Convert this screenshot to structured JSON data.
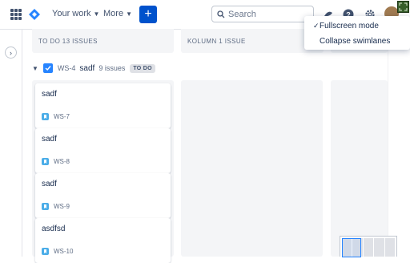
{
  "nav": {
    "your_work": "Your work",
    "more": "More",
    "create": "+",
    "search_placeholder": "Search"
  },
  "columns": [
    {
      "header": "TO DO 13 ISSUES"
    },
    {
      "header": "KOLUMN 1 ISSUE"
    }
  ],
  "swimlane": {
    "key": "WS-4",
    "summary": "sadf",
    "count": "9 issues",
    "status": "TO DO"
  },
  "cards": [
    {
      "title": "sadf",
      "key": "WS-7"
    },
    {
      "title": "sadf",
      "key": "WS-8"
    },
    {
      "title": "sadf",
      "key": "WS-9"
    },
    {
      "title": "asdfsd",
      "key": "WS-10"
    }
  ],
  "menu": {
    "fullscreen": "Fullscreen mode",
    "fullscreen_checked": "✓",
    "collapse": "Collapse swimlanes"
  },
  "colors": {
    "accent": "#0052cc",
    "story": "#4bade8",
    "column_bg": "#f4f5f7"
  }
}
